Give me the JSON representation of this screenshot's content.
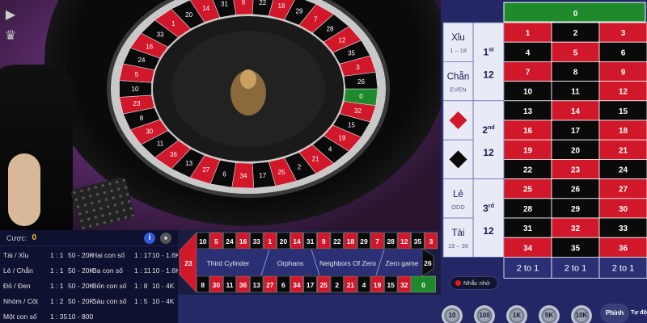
{
  "info": {
    "bet_label": "Cược:",
    "bet_amount": "0",
    "info_icon": "info-icon",
    "chip_icon": "spade-icon",
    "rows": [
      [
        "Tài / Xỉu",
        "1 : 1",
        "50 - 20K",
        "Hai con số",
        "1 : 17",
        "10 - 1.6K"
      ],
      [
        "Lẻ / Chẵn",
        "1 : 1",
        "50 - 20K",
        "Ba con số",
        "1 : 11",
        "10 - 1.6K"
      ],
      [
        "Đỏ / Đen",
        "1 : 1",
        "50 - 20K",
        "Bốn con số",
        "1 : 8",
        "10 - 4K"
      ],
      [
        "Nhóm / Cột",
        "1 : 2",
        "50 - 20K",
        "Sáu con số",
        "1 : 5",
        "10 - 4K"
      ],
      [
        "Một con số",
        "1 : 35",
        "10 - 800",
        "",
        "",
        ""
      ]
    ]
  },
  "racetrack": {
    "top": [
      "10",
      "5",
      "24",
      "16",
      "33",
      "1",
      "20",
      "14",
      "31",
      "9",
      "22",
      "18",
      "29",
      "7",
      "28",
      "12",
      "35",
      "3"
    ],
    "bottom": [
      "8",
      "30",
      "11",
      "36",
      "13",
      "27",
      "6",
      "34",
      "17",
      "25",
      "2",
      "21",
      "4",
      "19",
      "15",
      "32",
      "0"
    ],
    "left": "23",
    "right": "26",
    "sections": [
      "Third Cylinder",
      "Orphans",
      "Neighbors Of Zero",
      "Zero game"
    ]
  },
  "board": {
    "zero": "0",
    "numbers": [
      [
        "1",
        "2",
        "3"
      ],
      [
        "4",
        "5",
        "6"
      ],
      [
        "7",
        "8",
        "9"
      ],
      [
        "10",
        "11",
        "12"
      ],
      [
        "13",
        "14",
        "15"
      ],
      [
        "16",
        "17",
        "18"
      ],
      [
        "19",
        "20",
        "21"
      ],
      [
        "22",
        "23",
        "24"
      ],
      [
        "25",
        "26",
        "27"
      ],
      [
        "28",
        "29",
        "30"
      ],
      [
        "31",
        "32",
        "33"
      ],
      [
        "34",
        "35",
        "36"
      ]
    ],
    "red": [
      1,
      3,
      5,
      7,
      9,
      12,
      14,
      16,
      18,
      19,
      21,
      23,
      25,
      27,
      30,
      32,
      34,
      36
    ],
    "outside": {
      "xiu": "Xỉu",
      "xiu_range": "1 – 18",
      "chan": "Chẵn",
      "chan_sub": "EVEN",
      "le": "Lẻ",
      "le_sub": "ODD",
      "tai": "Tài",
      "tai_range": "19 – 36"
    },
    "dozens": [
      {
        "num": "1",
        "sup": "st",
        "val": "12"
      },
      {
        "num": "2",
        "sup": "nd",
        "val": "12"
      },
      {
        "num": "3",
        "sup": "rd",
        "val": "12"
      }
    ],
    "columns": [
      "2 to 1",
      "2 to 1",
      "2 to 1"
    ],
    "colors": {
      "red": "#d0182a",
      "black": "#0a0a0a",
      "green": "#1e8a2c",
      "panel": "#e8eaf6"
    }
  },
  "controls": {
    "reminder": "Nhắc nhở",
    "chips": [
      "10",
      "100",
      "1K",
      "5K",
      "10K"
    ],
    "double": "Phình",
    "auto": "Tự độ"
  }
}
